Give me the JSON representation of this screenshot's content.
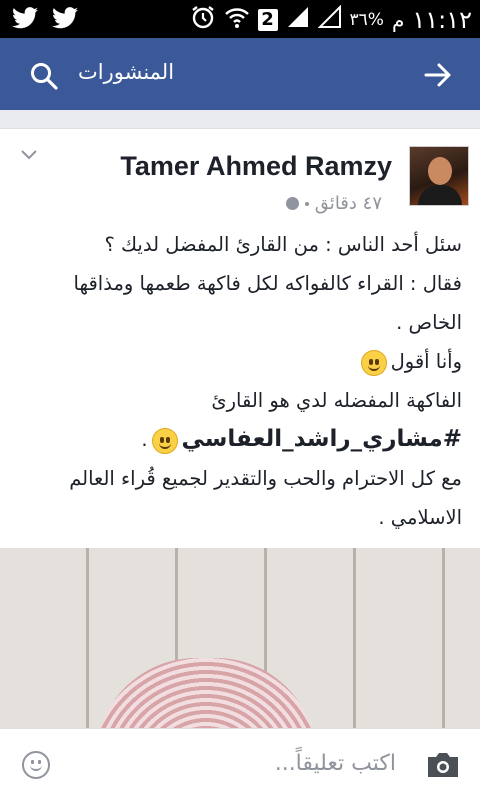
{
  "status_bar": {
    "time": "١١:١٢",
    "ampm": "م",
    "battery": "٣٦%",
    "sim_badge": "2"
  },
  "app_bar": {
    "title": "المنشورات"
  },
  "post": {
    "author": "Tamer Ahmed Ramzy",
    "timestamp": "٤٧ دقائق",
    "lines": [
      "سئل أحد الناس : من القارئ المفضل لديك ؟",
      "فقال : القراء كالفواكه لكل فاكهة طعمها ومذاقها الخاص .",
      "وأنا أقول",
      "الفاكهة المفضله لدي هو القارئ",
      "#مشاري_راشد_العفاسي",
      ".",
      "مع كل الاحترام والحب والتقدير لجميع قُراء العالم الاسلامي ."
    ]
  },
  "comment_bar": {
    "placeholder": "اكتب تعليقاً..."
  },
  "colors": {
    "brand": "#3b5998",
    "status_bar": "#000000",
    "muted_text": "#90949c"
  }
}
